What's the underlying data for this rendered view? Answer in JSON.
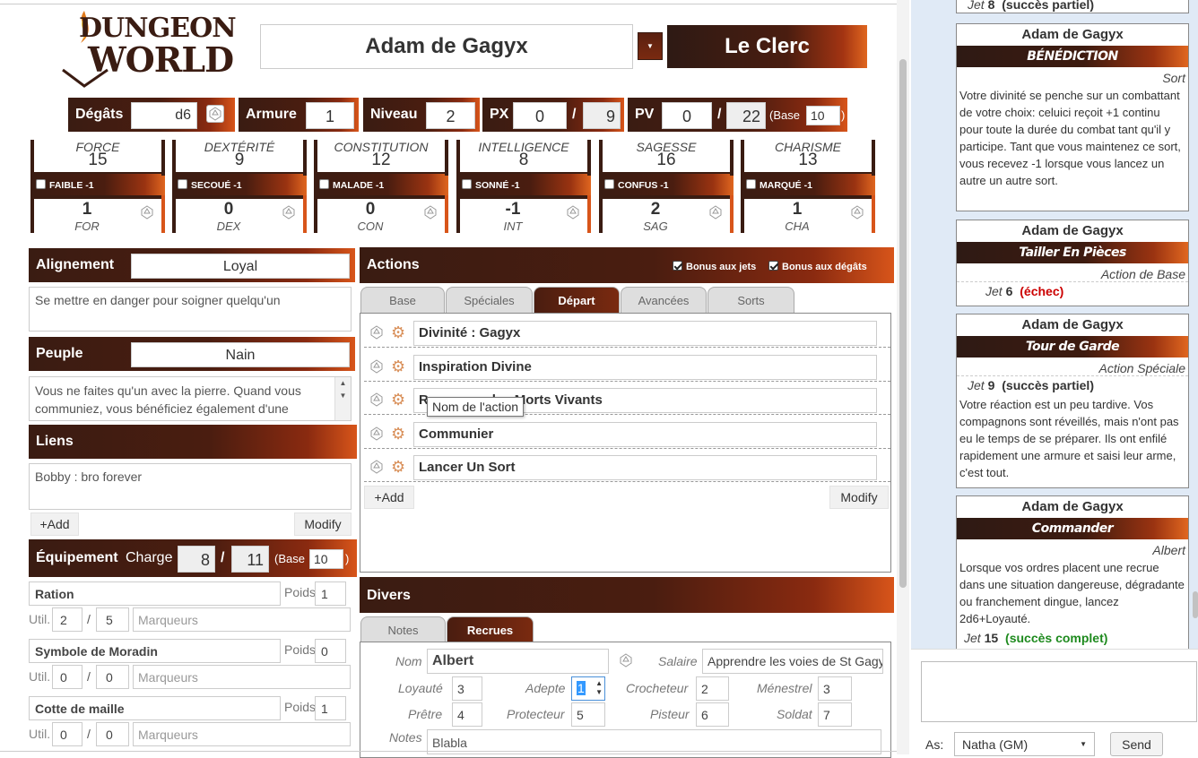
{
  "logo": {
    "line1": "DUNGEON",
    "line2": "WORLD"
  },
  "character": {
    "name": "Adam de Gagyx",
    "class_name": "Le Clerc"
  },
  "topstats": {
    "damage_label": "Dégâts",
    "damage": "d6",
    "armor_label": "Armure",
    "armor": "1",
    "level_label": "Niveau",
    "level": "2",
    "xp_label": "PX",
    "xp": "0",
    "xp_sep": "/",
    "xp_max": "9",
    "hp_label": "PV",
    "hp": "0",
    "hp_sep": "/",
    "hp_max": "22",
    "base_label": "(Base",
    "base": "10",
    "base_close": ")"
  },
  "stats": [
    {
      "name": "FORCE",
      "value": "15",
      "debility": "FAIBLE -1",
      "mod": "1",
      "abbr": "FOR"
    },
    {
      "name": "DEXTÉRITÉ",
      "value": "9",
      "debility": "SECOUÉ -1",
      "mod": "0",
      "abbr": "DEX"
    },
    {
      "name": "CONSTITUTION",
      "value": "12",
      "debility": "MALADE -1",
      "mod": "0",
      "abbr": "CON"
    },
    {
      "name": "INTELLIGENCE",
      "value": "8",
      "debility": "SONNÉ -1",
      "mod": "-1",
      "abbr": "INT"
    },
    {
      "name": "SAGESSE",
      "value": "16",
      "debility": "CONFUS -1",
      "mod": "2",
      "abbr": "SAG"
    },
    {
      "name": "CHARISME",
      "value": "13",
      "debility": "MARQUÉ -1",
      "mod": "1",
      "abbr": "CHA"
    }
  ],
  "alignment": {
    "label": "Alignement",
    "value": "Loyal",
    "text": "Se mettre en danger pour soigner quelqu'un"
  },
  "race": {
    "label": "Peuple",
    "value": "Nain",
    "text": "Vous ne faites qu'un avec la pierre. Quand vous communiez, vous bénéficiez également d'une"
  },
  "bonds": {
    "label": "Liens",
    "text": "Bobby : bro forever",
    "add": "+Add",
    "modify": "Modify"
  },
  "equipment": {
    "label": "Équipement",
    "load_label": "Charge",
    "load": "8",
    "sep": "/",
    "load_max": "11",
    "base_label": "(Base",
    "base": "10",
    "base_close": ")",
    "weight_label": "Poids",
    "uses_label": "Util.",
    "marker_placeholder": "Marqueurs",
    "items": [
      {
        "name": "Ration",
        "weight": "1",
        "uses": "2",
        "uses_max": "5"
      },
      {
        "name": "Symbole de Moradin",
        "weight": "0",
        "uses": "0",
        "uses_max": "0"
      },
      {
        "name": "Cotte de maille",
        "weight": "1",
        "uses": "0",
        "uses_max": "0"
      }
    ]
  },
  "actions": {
    "label": "Actions",
    "bonus_rolls": "Bonus aux jets",
    "bonus_damage": "Bonus aux dégâts",
    "tabs": [
      "Base",
      "Spéciales",
      "Départ",
      "Avancées",
      "Sorts"
    ],
    "items": [
      "Divinité : Gagyx",
      "Inspiration Divine",
      "Repousser les Morts Vivants",
      "Communier",
      "Lancer Un Sort"
    ],
    "tooltip": "Nom de l'action",
    "add": "+Add",
    "modify": "Modify"
  },
  "misc": {
    "label": "Divers",
    "tabs": [
      "Notes",
      "Recrues"
    ],
    "recruit": {
      "name_label": "Nom",
      "name": "Albert",
      "salary_label": "Salaire",
      "salary": "Apprendre les voies de St Gagyx",
      "loyalty_label": "Loyauté",
      "loyalty": "3",
      "adept_label": "Adepte",
      "adept": "1",
      "burglar_label": "Crocheteur",
      "burglar": "2",
      "minstrel_label": "Ménestrel",
      "minstrel": "3",
      "priest_label": "Prêtre",
      "priest": "4",
      "protector_label": "Protecteur",
      "protector": "5",
      "tracker_label": "Pisteur",
      "tracker": "6",
      "soldier_label": "Soldat",
      "soldier": "7",
      "notes_label": "Notes",
      "notes": "Blabla"
    }
  },
  "chat": {
    "top_roll": {
      "label": "Jet",
      "value": "8",
      "result": "(succès partiel)"
    },
    "cards": [
      {
        "who": "Adam de Gagyx",
        "title": "BÉNÉDICTION",
        "sub": "Sort",
        "body": "Votre divinité se penche sur un combattant de votre choix: celuici reçoit +1 continu pour toute la durée du combat tant qu'il y participe. Tant que vous maintenez ce sort, vous recevez -1 lorsque vous lancez un autre un autre sort."
      },
      {
        "who": "Adam de Gagyx",
        "title": "Tailler En Pièces",
        "sub": "Action de Base",
        "roll_label": "Jet",
        "roll": "6",
        "result": "(échec)"
      },
      {
        "who": "Adam de Gagyx",
        "title": "Tour de Garde",
        "sub": "Action Spéciale",
        "roll_label": "Jet",
        "roll": "9",
        "result": "(succès partiel)",
        "body": "Votre réaction est un peu tardive. Vos compagnons sont réveillés, mais n'ont pas eu le temps de se préparer. Ils ont enfilé rapidement une armure et saisi leur arme, c'est tout."
      },
      {
        "who": "Adam de Gagyx",
        "title": "Commander",
        "sub": "Albert",
        "body": "Lorsque vos ordres placent une recrue dans une situation dangereuse, dégradante ou franchement dingue, lancez 2d6+Loyauté.",
        "roll_label": "Jet",
        "roll": "15",
        "result": "(succès complet)"
      }
    ],
    "as_label": "As:",
    "as_value": "Natha (GM)",
    "send": "Send"
  },
  "colors": {
    "dark": "#3a1c12",
    "accent": "#d8551a",
    "fail": "#cc0000",
    "success": "#1e8a1e"
  }
}
